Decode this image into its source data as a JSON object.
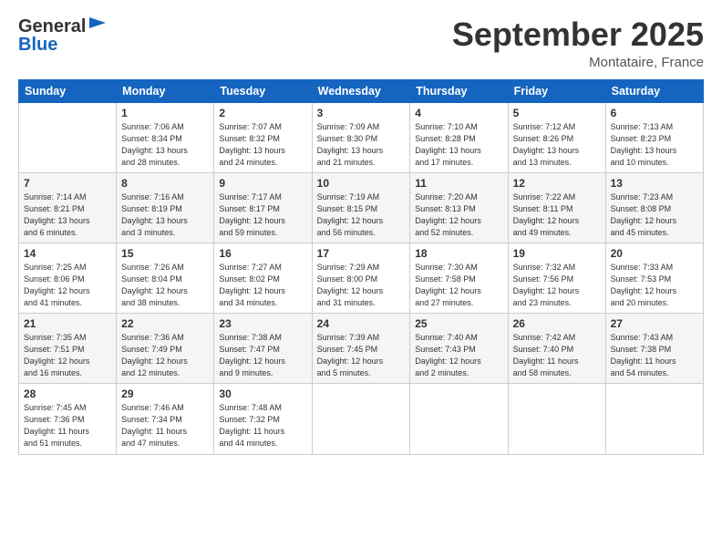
{
  "header": {
    "logo_general": "General",
    "logo_blue": "Blue",
    "month_title": "September 2025",
    "location": "Montataire, France"
  },
  "days_of_week": [
    "Sunday",
    "Monday",
    "Tuesday",
    "Wednesday",
    "Thursday",
    "Friday",
    "Saturday"
  ],
  "weeks": [
    [
      {
        "day": "",
        "info": ""
      },
      {
        "day": "1",
        "info": "Sunrise: 7:06 AM\nSunset: 8:34 PM\nDaylight: 13 hours\nand 28 minutes."
      },
      {
        "day": "2",
        "info": "Sunrise: 7:07 AM\nSunset: 8:32 PM\nDaylight: 13 hours\nand 24 minutes."
      },
      {
        "day": "3",
        "info": "Sunrise: 7:09 AM\nSunset: 8:30 PM\nDaylight: 13 hours\nand 21 minutes."
      },
      {
        "day": "4",
        "info": "Sunrise: 7:10 AM\nSunset: 8:28 PM\nDaylight: 13 hours\nand 17 minutes."
      },
      {
        "day": "5",
        "info": "Sunrise: 7:12 AM\nSunset: 8:26 PM\nDaylight: 13 hours\nand 13 minutes."
      },
      {
        "day": "6",
        "info": "Sunrise: 7:13 AM\nSunset: 8:23 PM\nDaylight: 13 hours\nand 10 minutes."
      }
    ],
    [
      {
        "day": "7",
        "info": "Sunrise: 7:14 AM\nSunset: 8:21 PM\nDaylight: 13 hours\nand 6 minutes."
      },
      {
        "day": "8",
        "info": "Sunrise: 7:16 AM\nSunset: 8:19 PM\nDaylight: 13 hours\nand 3 minutes."
      },
      {
        "day": "9",
        "info": "Sunrise: 7:17 AM\nSunset: 8:17 PM\nDaylight: 12 hours\nand 59 minutes."
      },
      {
        "day": "10",
        "info": "Sunrise: 7:19 AM\nSunset: 8:15 PM\nDaylight: 12 hours\nand 56 minutes."
      },
      {
        "day": "11",
        "info": "Sunrise: 7:20 AM\nSunset: 8:13 PM\nDaylight: 12 hours\nand 52 minutes."
      },
      {
        "day": "12",
        "info": "Sunrise: 7:22 AM\nSunset: 8:11 PM\nDaylight: 12 hours\nand 49 minutes."
      },
      {
        "day": "13",
        "info": "Sunrise: 7:23 AM\nSunset: 8:08 PM\nDaylight: 12 hours\nand 45 minutes."
      }
    ],
    [
      {
        "day": "14",
        "info": "Sunrise: 7:25 AM\nSunset: 8:06 PM\nDaylight: 12 hours\nand 41 minutes."
      },
      {
        "day": "15",
        "info": "Sunrise: 7:26 AM\nSunset: 8:04 PM\nDaylight: 12 hours\nand 38 minutes."
      },
      {
        "day": "16",
        "info": "Sunrise: 7:27 AM\nSunset: 8:02 PM\nDaylight: 12 hours\nand 34 minutes."
      },
      {
        "day": "17",
        "info": "Sunrise: 7:29 AM\nSunset: 8:00 PM\nDaylight: 12 hours\nand 31 minutes."
      },
      {
        "day": "18",
        "info": "Sunrise: 7:30 AM\nSunset: 7:58 PM\nDaylight: 12 hours\nand 27 minutes."
      },
      {
        "day": "19",
        "info": "Sunrise: 7:32 AM\nSunset: 7:56 PM\nDaylight: 12 hours\nand 23 minutes."
      },
      {
        "day": "20",
        "info": "Sunrise: 7:33 AM\nSunset: 7:53 PM\nDaylight: 12 hours\nand 20 minutes."
      }
    ],
    [
      {
        "day": "21",
        "info": "Sunrise: 7:35 AM\nSunset: 7:51 PM\nDaylight: 12 hours\nand 16 minutes."
      },
      {
        "day": "22",
        "info": "Sunrise: 7:36 AM\nSunset: 7:49 PM\nDaylight: 12 hours\nand 12 minutes."
      },
      {
        "day": "23",
        "info": "Sunrise: 7:38 AM\nSunset: 7:47 PM\nDaylight: 12 hours\nand 9 minutes."
      },
      {
        "day": "24",
        "info": "Sunrise: 7:39 AM\nSunset: 7:45 PM\nDaylight: 12 hours\nand 5 minutes."
      },
      {
        "day": "25",
        "info": "Sunrise: 7:40 AM\nSunset: 7:43 PM\nDaylight: 12 hours\nand 2 minutes."
      },
      {
        "day": "26",
        "info": "Sunrise: 7:42 AM\nSunset: 7:40 PM\nDaylight: 11 hours\nand 58 minutes."
      },
      {
        "day": "27",
        "info": "Sunrise: 7:43 AM\nSunset: 7:38 PM\nDaylight: 11 hours\nand 54 minutes."
      }
    ],
    [
      {
        "day": "28",
        "info": "Sunrise: 7:45 AM\nSunset: 7:36 PM\nDaylight: 11 hours\nand 51 minutes."
      },
      {
        "day": "29",
        "info": "Sunrise: 7:46 AM\nSunset: 7:34 PM\nDaylight: 11 hours\nand 47 minutes."
      },
      {
        "day": "30",
        "info": "Sunrise: 7:48 AM\nSunset: 7:32 PM\nDaylight: 11 hours\nand 44 minutes."
      },
      {
        "day": "",
        "info": ""
      },
      {
        "day": "",
        "info": ""
      },
      {
        "day": "",
        "info": ""
      },
      {
        "day": "",
        "info": ""
      }
    ]
  ]
}
